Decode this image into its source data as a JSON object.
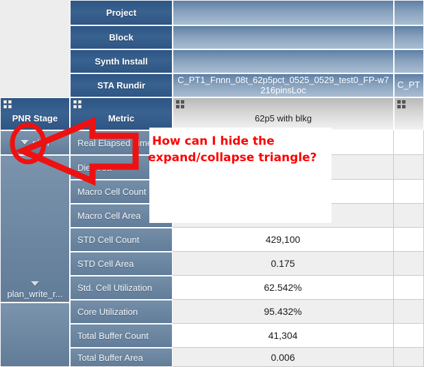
{
  "header_rows": [
    {
      "label": "Project",
      "value": ""
    },
    {
      "label": "Block",
      "value": ""
    },
    {
      "label": "Synth Install",
      "value": ""
    },
    {
      "label": "STA Rundir",
      "value": "C_PT1_Fnnn_08t_62p5pct_0525_0529_test0_FP-w7216pinsLoc"
    }
  ],
  "header_rows_col2": [
    {
      "value": ""
    },
    {
      "value": ""
    },
    {
      "value": ""
    },
    {
      "value": "C_PT"
    }
  ],
  "column_group": {
    "stage_header": "PNR Stage",
    "metric_header": "Metric",
    "value_header": "62p5 with blkg",
    "value_header_col2": "",
    "grid_icon": "four-square-grid-icon"
  },
  "stages": [
    {
      "label": "plan",
      "triangle": "collapse-triangle-down"
    },
    {
      "label": "plan_write_r...",
      "triangle": "collapse-triangle-down"
    }
  ],
  "rows": [
    {
      "metric": "Real Elapsed Time",
      "value": ""
    },
    {
      "metric": "Die Area",
      "value": ""
    },
    {
      "metric": "Macro Cell Count",
      "value": ""
    },
    {
      "metric": "Macro Cell Area",
      "value": ""
    },
    {
      "metric": "STD Cell Count",
      "value": "429,100"
    },
    {
      "metric": "STD Cell Area",
      "value": "0.175"
    },
    {
      "metric": "Std. Cell Utilization",
      "value": "62.542%"
    },
    {
      "metric": "Core Utilization",
      "value": "95.432%"
    },
    {
      "metric": "Total Buffer Count",
      "value": "41,304"
    },
    {
      "metric": "Total Buffer Area",
      "value": "0.006"
    }
  ],
  "annotation": {
    "line1": "How can I hide the",
    "line2": "expand/collapse triangle?",
    "color": "#ff0000",
    "arrow": "left-pointing-arrow",
    "ellipse": "highlight-ellipse"
  },
  "colors": {
    "header_blue": "#2d5585",
    "row_blue": "#6b86a1",
    "stripe": "#efefef",
    "page_bg": "#ededed",
    "annotation_red": "#ff0000"
  }
}
